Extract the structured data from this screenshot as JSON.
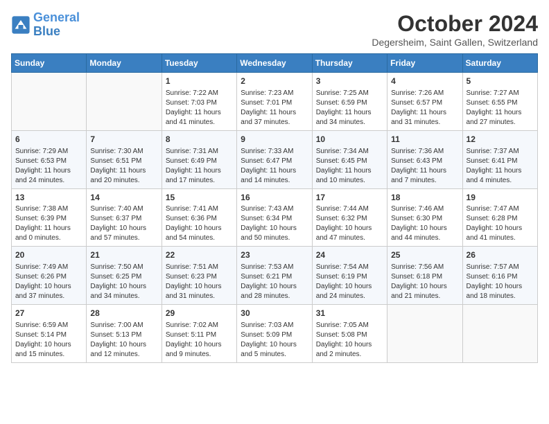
{
  "header": {
    "logo_line1": "General",
    "logo_line2": "Blue",
    "month": "October 2024",
    "location": "Degersheim, Saint Gallen, Switzerland"
  },
  "weekdays": [
    "Sunday",
    "Monday",
    "Tuesday",
    "Wednesday",
    "Thursday",
    "Friday",
    "Saturday"
  ],
  "weeks": [
    [
      {
        "day": "",
        "info": ""
      },
      {
        "day": "",
        "info": ""
      },
      {
        "day": "1",
        "info": "Sunrise: 7:22 AM\nSunset: 7:03 PM\nDaylight: 11 hours and 41 minutes."
      },
      {
        "day": "2",
        "info": "Sunrise: 7:23 AM\nSunset: 7:01 PM\nDaylight: 11 hours and 37 minutes."
      },
      {
        "day": "3",
        "info": "Sunrise: 7:25 AM\nSunset: 6:59 PM\nDaylight: 11 hours and 34 minutes."
      },
      {
        "day": "4",
        "info": "Sunrise: 7:26 AM\nSunset: 6:57 PM\nDaylight: 11 hours and 31 minutes."
      },
      {
        "day": "5",
        "info": "Sunrise: 7:27 AM\nSunset: 6:55 PM\nDaylight: 11 hours and 27 minutes."
      }
    ],
    [
      {
        "day": "6",
        "info": "Sunrise: 7:29 AM\nSunset: 6:53 PM\nDaylight: 11 hours and 24 minutes."
      },
      {
        "day": "7",
        "info": "Sunrise: 7:30 AM\nSunset: 6:51 PM\nDaylight: 11 hours and 20 minutes."
      },
      {
        "day": "8",
        "info": "Sunrise: 7:31 AM\nSunset: 6:49 PM\nDaylight: 11 hours and 17 minutes."
      },
      {
        "day": "9",
        "info": "Sunrise: 7:33 AM\nSunset: 6:47 PM\nDaylight: 11 hours and 14 minutes."
      },
      {
        "day": "10",
        "info": "Sunrise: 7:34 AM\nSunset: 6:45 PM\nDaylight: 11 hours and 10 minutes."
      },
      {
        "day": "11",
        "info": "Sunrise: 7:36 AM\nSunset: 6:43 PM\nDaylight: 11 hours and 7 minutes."
      },
      {
        "day": "12",
        "info": "Sunrise: 7:37 AM\nSunset: 6:41 PM\nDaylight: 11 hours and 4 minutes."
      }
    ],
    [
      {
        "day": "13",
        "info": "Sunrise: 7:38 AM\nSunset: 6:39 PM\nDaylight: 11 hours and 0 minutes."
      },
      {
        "day": "14",
        "info": "Sunrise: 7:40 AM\nSunset: 6:37 PM\nDaylight: 10 hours and 57 minutes."
      },
      {
        "day": "15",
        "info": "Sunrise: 7:41 AM\nSunset: 6:36 PM\nDaylight: 10 hours and 54 minutes."
      },
      {
        "day": "16",
        "info": "Sunrise: 7:43 AM\nSunset: 6:34 PM\nDaylight: 10 hours and 50 minutes."
      },
      {
        "day": "17",
        "info": "Sunrise: 7:44 AM\nSunset: 6:32 PM\nDaylight: 10 hours and 47 minutes."
      },
      {
        "day": "18",
        "info": "Sunrise: 7:46 AM\nSunset: 6:30 PM\nDaylight: 10 hours and 44 minutes."
      },
      {
        "day": "19",
        "info": "Sunrise: 7:47 AM\nSunset: 6:28 PM\nDaylight: 10 hours and 41 minutes."
      }
    ],
    [
      {
        "day": "20",
        "info": "Sunrise: 7:49 AM\nSunset: 6:26 PM\nDaylight: 10 hours and 37 minutes."
      },
      {
        "day": "21",
        "info": "Sunrise: 7:50 AM\nSunset: 6:25 PM\nDaylight: 10 hours and 34 minutes."
      },
      {
        "day": "22",
        "info": "Sunrise: 7:51 AM\nSunset: 6:23 PM\nDaylight: 10 hours and 31 minutes."
      },
      {
        "day": "23",
        "info": "Sunrise: 7:53 AM\nSunset: 6:21 PM\nDaylight: 10 hours and 28 minutes."
      },
      {
        "day": "24",
        "info": "Sunrise: 7:54 AM\nSunset: 6:19 PM\nDaylight: 10 hours and 24 minutes."
      },
      {
        "day": "25",
        "info": "Sunrise: 7:56 AM\nSunset: 6:18 PM\nDaylight: 10 hours and 21 minutes."
      },
      {
        "day": "26",
        "info": "Sunrise: 7:57 AM\nSunset: 6:16 PM\nDaylight: 10 hours and 18 minutes."
      }
    ],
    [
      {
        "day": "27",
        "info": "Sunrise: 6:59 AM\nSunset: 5:14 PM\nDaylight: 10 hours and 15 minutes."
      },
      {
        "day": "28",
        "info": "Sunrise: 7:00 AM\nSunset: 5:13 PM\nDaylight: 10 hours and 12 minutes."
      },
      {
        "day": "29",
        "info": "Sunrise: 7:02 AM\nSunset: 5:11 PM\nDaylight: 10 hours and 9 minutes."
      },
      {
        "day": "30",
        "info": "Sunrise: 7:03 AM\nSunset: 5:09 PM\nDaylight: 10 hours and 5 minutes."
      },
      {
        "day": "31",
        "info": "Sunrise: 7:05 AM\nSunset: 5:08 PM\nDaylight: 10 hours and 2 minutes."
      },
      {
        "day": "",
        "info": ""
      },
      {
        "day": "",
        "info": ""
      }
    ]
  ]
}
